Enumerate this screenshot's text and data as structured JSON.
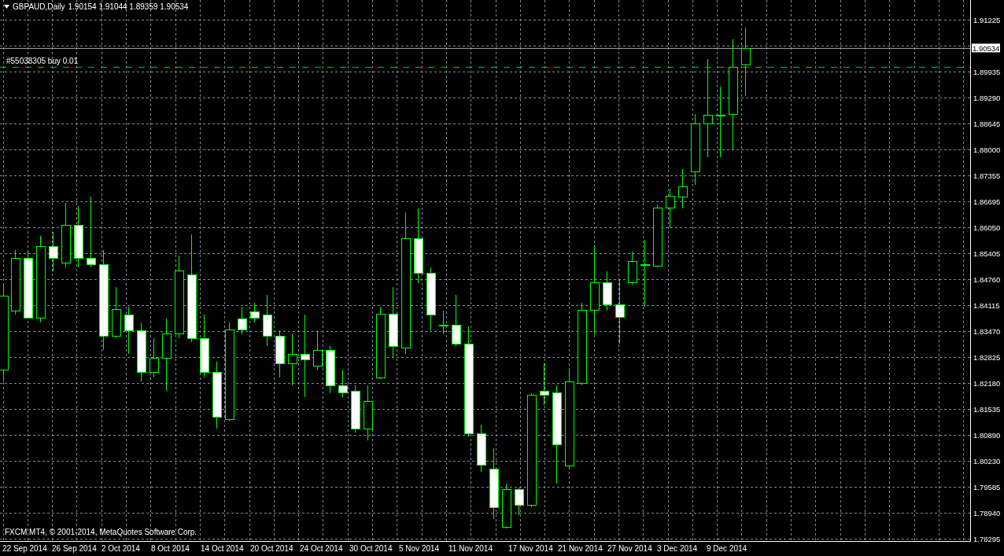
{
  "chart": {
    "symbol": "GBPAUD,Daily",
    "ohlc": "1.90154 1.91044 1.89359 1.90534",
    "order_label": "#55038305 buy 0.01",
    "copyright": "FXCM MT4, © 2001-2014, MetaQuotes Software Corp."
  },
  "price_axis": {
    "current_price": "1.90534",
    "labels": [
      "1.91225",
      "1.89935",
      "1.89290",
      "1.88645",
      "1.88000",
      "1.87355",
      "1.86695",
      "1.86050",
      "1.85405",
      "1.84760",
      "1.84115",
      "1.83470",
      "1.82825",
      "1.82180",
      "1.81535",
      "1.80890",
      "1.80230",
      "1.79585",
      "1.78940",
      "1.78295"
    ]
  },
  "time_axis": {
    "labels": [
      "22 Sep 2014",
      "26 Sep 2014",
      "2 Oct 2014",
      "8 Oct 2014",
      "14 Oct 2014",
      "20 Oct 2014",
      "24 Oct 2014",
      "30 Oct 2014",
      "5 Nov 2014",
      "11 Nov 2014",
      "17 Nov 2014",
      "21 Nov 2014",
      "27 Nov 2014",
      "3 Dec 2014",
      "9 Dec 2014"
    ]
  }
}
